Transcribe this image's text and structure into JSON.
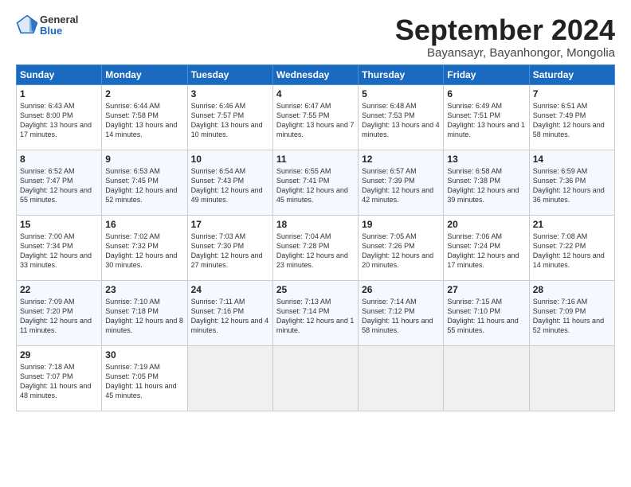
{
  "logo": {
    "general": "General",
    "blue": "Blue"
  },
  "title": "September 2024",
  "subtitle": "Bayansayr, Bayanhongor, Mongolia",
  "headers": [
    "Sunday",
    "Monday",
    "Tuesday",
    "Wednesday",
    "Thursday",
    "Friday",
    "Saturday"
  ],
  "weeks": [
    [
      {
        "day": "1",
        "info": "Sunrise: 6:43 AM\nSunset: 8:00 PM\nDaylight: 13 hours and 17 minutes."
      },
      {
        "day": "2",
        "info": "Sunrise: 6:44 AM\nSunset: 7:58 PM\nDaylight: 13 hours and 14 minutes."
      },
      {
        "day": "3",
        "info": "Sunrise: 6:46 AM\nSunset: 7:57 PM\nDaylight: 13 hours and 10 minutes."
      },
      {
        "day": "4",
        "info": "Sunrise: 6:47 AM\nSunset: 7:55 PM\nDaylight: 13 hours and 7 minutes."
      },
      {
        "day": "5",
        "info": "Sunrise: 6:48 AM\nSunset: 7:53 PM\nDaylight: 13 hours and 4 minutes."
      },
      {
        "day": "6",
        "info": "Sunrise: 6:49 AM\nSunset: 7:51 PM\nDaylight: 13 hours and 1 minute."
      },
      {
        "day": "7",
        "info": "Sunrise: 6:51 AM\nSunset: 7:49 PM\nDaylight: 12 hours and 58 minutes."
      }
    ],
    [
      {
        "day": "8",
        "info": "Sunrise: 6:52 AM\nSunset: 7:47 PM\nDaylight: 12 hours and 55 minutes."
      },
      {
        "day": "9",
        "info": "Sunrise: 6:53 AM\nSunset: 7:45 PM\nDaylight: 12 hours and 52 minutes."
      },
      {
        "day": "10",
        "info": "Sunrise: 6:54 AM\nSunset: 7:43 PM\nDaylight: 12 hours and 49 minutes."
      },
      {
        "day": "11",
        "info": "Sunrise: 6:55 AM\nSunset: 7:41 PM\nDaylight: 12 hours and 45 minutes."
      },
      {
        "day": "12",
        "info": "Sunrise: 6:57 AM\nSunset: 7:39 PM\nDaylight: 12 hours and 42 minutes."
      },
      {
        "day": "13",
        "info": "Sunrise: 6:58 AM\nSunset: 7:38 PM\nDaylight: 12 hours and 39 minutes."
      },
      {
        "day": "14",
        "info": "Sunrise: 6:59 AM\nSunset: 7:36 PM\nDaylight: 12 hours and 36 minutes."
      }
    ],
    [
      {
        "day": "15",
        "info": "Sunrise: 7:00 AM\nSunset: 7:34 PM\nDaylight: 12 hours and 33 minutes."
      },
      {
        "day": "16",
        "info": "Sunrise: 7:02 AM\nSunset: 7:32 PM\nDaylight: 12 hours and 30 minutes."
      },
      {
        "day": "17",
        "info": "Sunrise: 7:03 AM\nSunset: 7:30 PM\nDaylight: 12 hours and 27 minutes."
      },
      {
        "day": "18",
        "info": "Sunrise: 7:04 AM\nSunset: 7:28 PM\nDaylight: 12 hours and 23 minutes."
      },
      {
        "day": "19",
        "info": "Sunrise: 7:05 AM\nSunset: 7:26 PM\nDaylight: 12 hours and 20 minutes."
      },
      {
        "day": "20",
        "info": "Sunrise: 7:06 AM\nSunset: 7:24 PM\nDaylight: 12 hours and 17 minutes."
      },
      {
        "day": "21",
        "info": "Sunrise: 7:08 AM\nSunset: 7:22 PM\nDaylight: 12 hours and 14 minutes."
      }
    ],
    [
      {
        "day": "22",
        "info": "Sunrise: 7:09 AM\nSunset: 7:20 PM\nDaylight: 12 hours and 11 minutes."
      },
      {
        "day": "23",
        "info": "Sunrise: 7:10 AM\nSunset: 7:18 PM\nDaylight: 12 hours and 8 minutes."
      },
      {
        "day": "24",
        "info": "Sunrise: 7:11 AM\nSunset: 7:16 PM\nDaylight: 12 hours and 4 minutes."
      },
      {
        "day": "25",
        "info": "Sunrise: 7:13 AM\nSunset: 7:14 PM\nDaylight: 12 hours and 1 minute."
      },
      {
        "day": "26",
        "info": "Sunrise: 7:14 AM\nSunset: 7:12 PM\nDaylight: 11 hours and 58 minutes."
      },
      {
        "day": "27",
        "info": "Sunrise: 7:15 AM\nSunset: 7:10 PM\nDaylight: 11 hours and 55 minutes."
      },
      {
        "day": "28",
        "info": "Sunrise: 7:16 AM\nSunset: 7:09 PM\nDaylight: 11 hours and 52 minutes."
      }
    ],
    [
      {
        "day": "29",
        "info": "Sunrise: 7:18 AM\nSunset: 7:07 PM\nDaylight: 11 hours and 48 minutes."
      },
      {
        "day": "30",
        "info": "Sunrise: 7:19 AM\nSunset: 7:05 PM\nDaylight: 11 hours and 45 minutes."
      },
      {
        "day": "",
        "info": ""
      },
      {
        "day": "",
        "info": ""
      },
      {
        "day": "",
        "info": ""
      },
      {
        "day": "",
        "info": ""
      },
      {
        "day": "",
        "info": ""
      }
    ]
  ]
}
